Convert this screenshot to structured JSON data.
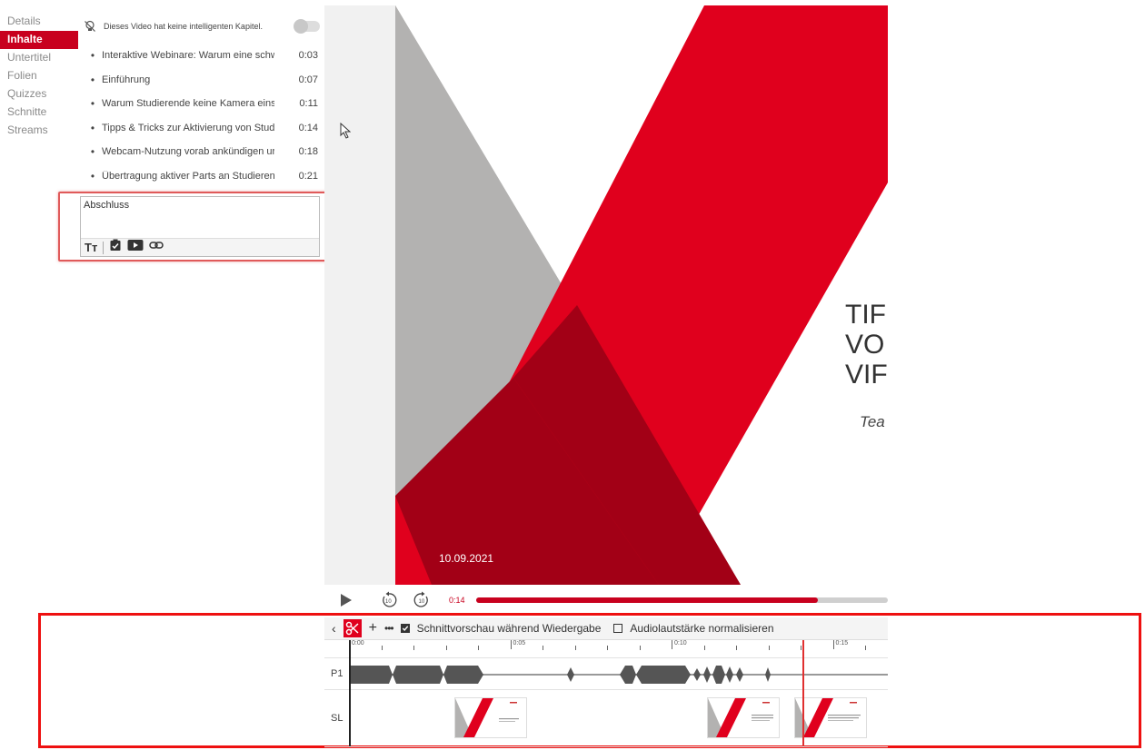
{
  "sidebar": {
    "items": [
      "Details",
      "Inhalte",
      "Untertitel",
      "Folien",
      "Quizzes",
      "Schnitte",
      "Streams"
    ],
    "active_index": 1
  },
  "chapters": {
    "notice": "Dieses Video hat keine intelligenten Kapitel.",
    "toggle_on": false,
    "items": [
      {
        "title": "Interaktive Webinare: Warum eine schw",
        "time": "0:03"
      },
      {
        "title": "Einführung",
        "time": "0:07"
      },
      {
        "title": "Warum Studierende keine Kamera einsc",
        "time": "0:11"
      },
      {
        "title": "Tipps & Tricks zur Aktivierung von Studi",
        "time": "0:14"
      },
      {
        "title": "Webcam-Nutzung vorab ankündigen ur",
        "time": "0:18"
      },
      {
        "title": "Übertragung aktiver Parts an Studierenc",
        "time": "0:21"
      }
    ],
    "editor_value": "Abschluss",
    "editor_tools": [
      "text-size-icon",
      "quiz-icon",
      "video-icon",
      "link-icon"
    ]
  },
  "slide": {
    "title_lines": [
      "TIF",
      "VO",
      "VIF"
    ],
    "subtitle": "Tea",
    "date": "10.09.2021",
    "colors": {
      "red": "#e0001d",
      "dark_red": "#a20016",
      "gray": "#b3b2b1"
    }
  },
  "player": {
    "current_time": "0:14",
    "progress": 0.83,
    "accent": "#c8001e"
  },
  "timeline": {
    "option_preview": "Schnittvorschau während Wiedergabe",
    "option_preview_checked": true,
    "option_normalize": "Audiolautstärke normalisieren",
    "option_normalize_checked": false,
    "ruler_labels": [
      "0:00",
      "0:05",
      "0:10",
      "0:15"
    ],
    "tracks": [
      "P1",
      "SL"
    ]
  }
}
